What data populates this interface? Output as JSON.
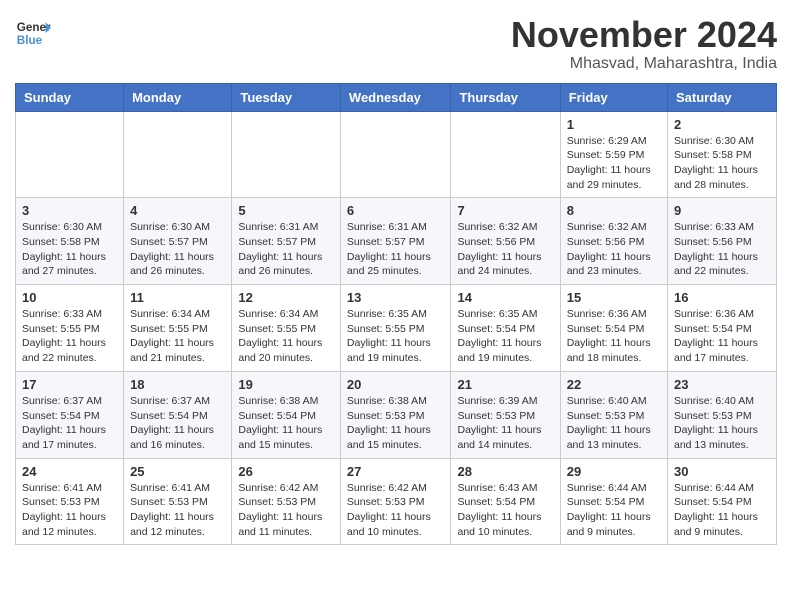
{
  "header": {
    "logo_line1": "General",
    "logo_line2": "Blue",
    "month_title": "November 2024",
    "location": "Mhasvad, Maharashtra, India"
  },
  "weekdays": [
    "Sunday",
    "Monday",
    "Tuesday",
    "Wednesday",
    "Thursday",
    "Friday",
    "Saturday"
  ],
  "weeks": [
    [
      null,
      null,
      null,
      null,
      null,
      {
        "day": 1,
        "sunrise": "6:29 AM",
        "sunset": "5:59 PM",
        "daylight": "11 hours and 29 minutes."
      },
      {
        "day": 2,
        "sunrise": "6:30 AM",
        "sunset": "5:58 PM",
        "daylight": "11 hours and 28 minutes."
      }
    ],
    [
      {
        "day": 3,
        "sunrise": "6:30 AM",
        "sunset": "5:58 PM",
        "daylight": "11 hours and 27 minutes."
      },
      {
        "day": 4,
        "sunrise": "6:30 AM",
        "sunset": "5:57 PM",
        "daylight": "11 hours and 26 minutes."
      },
      {
        "day": 5,
        "sunrise": "6:31 AM",
        "sunset": "5:57 PM",
        "daylight": "11 hours and 26 minutes."
      },
      {
        "day": 6,
        "sunrise": "6:31 AM",
        "sunset": "5:57 PM",
        "daylight": "11 hours and 25 minutes."
      },
      {
        "day": 7,
        "sunrise": "6:32 AM",
        "sunset": "5:56 PM",
        "daylight": "11 hours and 24 minutes."
      },
      {
        "day": 8,
        "sunrise": "6:32 AM",
        "sunset": "5:56 PM",
        "daylight": "11 hours and 23 minutes."
      },
      {
        "day": 9,
        "sunrise": "6:33 AM",
        "sunset": "5:56 PM",
        "daylight": "11 hours and 22 minutes."
      }
    ],
    [
      {
        "day": 10,
        "sunrise": "6:33 AM",
        "sunset": "5:55 PM",
        "daylight": "11 hours and 22 minutes."
      },
      {
        "day": 11,
        "sunrise": "6:34 AM",
        "sunset": "5:55 PM",
        "daylight": "11 hours and 21 minutes."
      },
      {
        "day": 12,
        "sunrise": "6:34 AM",
        "sunset": "5:55 PM",
        "daylight": "11 hours and 20 minutes."
      },
      {
        "day": 13,
        "sunrise": "6:35 AM",
        "sunset": "5:55 PM",
        "daylight": "11 hours and 19 minutes."
      },
      {
        "day": 14,
        "sunrise": "6:35 AM",
        "sunset": "5:54 PM",
        "daylight": "11 hours and 19 minutes."
      },
      {
        "day": 15,
        "sunrise": "6:36 AM",
        "sunset": "5:54 PM",
        "daylight": "11 hours and 18 minutes."
      },
      {
        "day": 16,
        "sunrise": "6:36 AM",
        "sunset": "5:54 PM",
        "daylight": "11 hours and 17 minutes."
      }
    ],
    [
      {
        "day": 17,
        "sunrise": "6:37 AM",
        "sunset": "5:54 PM",
        "daylight": "11 hours and 17 minutes."
      },
      {
        "day": 18,
        "sunrise": "6:37 AM",
        "sunset": "5:54 PM",
        "daylight": "11 hours and 16 minutes."
      },
      {
        "day": 19,
        "sunrise": "6:38 AM",
        "sunset": "5:54 PM",
        "daylight": "11 hours and 15 minutes."
      },
      {
        "day": 20,
        "sunrise": "6:38 AM",
        "sunset": "5:53 PM",
        "daylight": "11 hours and 15 minutes."
      },
      {
        "day": 21,
        "sunrise": "6:39 AM",
        "sunset": "5:53 PM",
        "daylight": "11 hours and 14 minutes."
      },
      {
        "day": 22,
        "sunrise": "6:40 AM",
        "sunset": "5:53 PM",
        "daylight": "11 hours and 13 minutes."
      },
      {
        "day": 23,
        "sunrise": "6:40 AM",
        "sunset": "5:53 PM",
        "daylight": "11 hours and 13 minutes."
      }
    ],
    [
      {
        "day": 24,
        "sunrise": "6:41 AM",
        "sunset": "5:53 PM",
        "daylight": "11 hours and 12 minutes."
      },
      {
        "day": 25,
        "sunrise": "6:41 AM",
        "sunset": "5:53 PM",
        "daylight": "11 hours and 12 minutes."
      },
      {
        "day": 26,
        "sunrise": "6:42 AM",
        "sunset": "5:53 PM",
        "daylight": "11 hours and 11 minutes."
      },
      {
        "day": 27,
        "sunrise": "6:42 AM",
        "sunset": "5:53 PM",
        "daylight": "11 hours and 10 minutes."
      },
      {
        "day": 28,
        "sunrise": "6:43 AM",
        "sunset": "5:54 PM",
        "daylight": "11 hours and 10 minutes."
      },
      {
        "day": 29,
        "sunrise": "6:44 AM",
        "sunset": "5:54 PM",
        "daylight": "11 hours and 9 minutes."
      },
      {
        "day": 30,
        "sunrise": "6:44 AM",
        "sunset": "5:54 PM",
        "daylight": "11 hours and 9 minutes."
      }
    ]
  ]
}
